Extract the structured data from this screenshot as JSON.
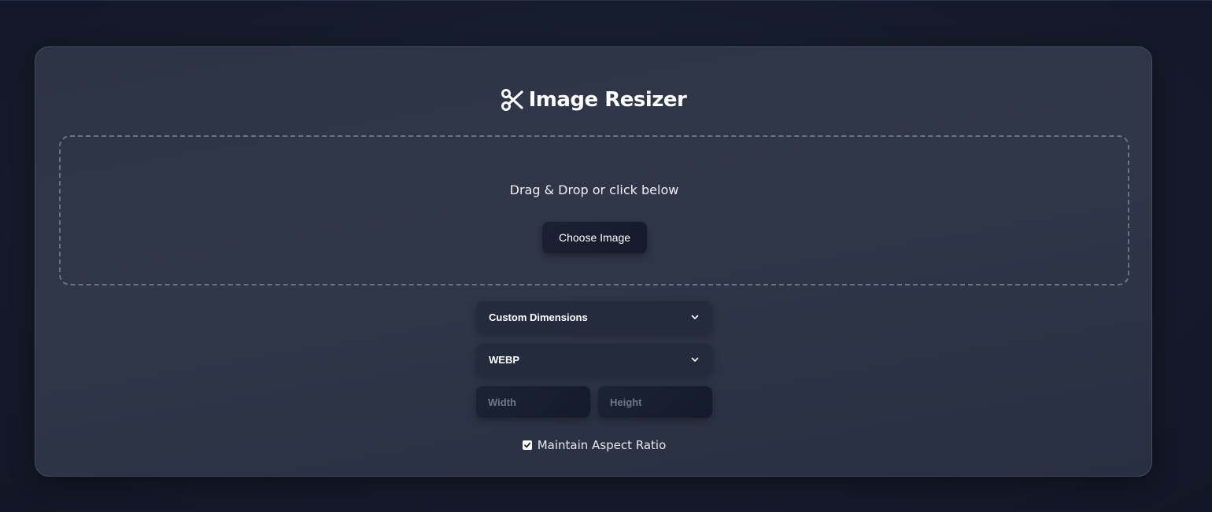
{
  "app": {
    "title": "Image Resizer",
    "title_icon": "scissors-icon"
  },
  "upload": {
    "prompt": "Drag & Drop or click below",
    "button_label": "Choose Image"
  },
  "controls": {
    "mode_select": {
      "selected": "Custom Dimensions",
      "icon": "chevron-down-icon"
    },
    "format_select": {
      "selected": "WEBP",
      "icon": "chevron-down-icon"
    },
    "width_input": {
      "value": "",
      "placeholder": "Width"
    },
    "height_input": {
      "value": "",
      "placeholder": "Height"
    },
    "aspect_ratio": {
      "label": "Maintain Aspect Ratio",
      "checked": true
    }
  },
  "colors": {
    "background": "#151b2b",
    "card": "#2f3648",
    "button": "#171d2e",
    "text": "#ffffff"
  }
}
